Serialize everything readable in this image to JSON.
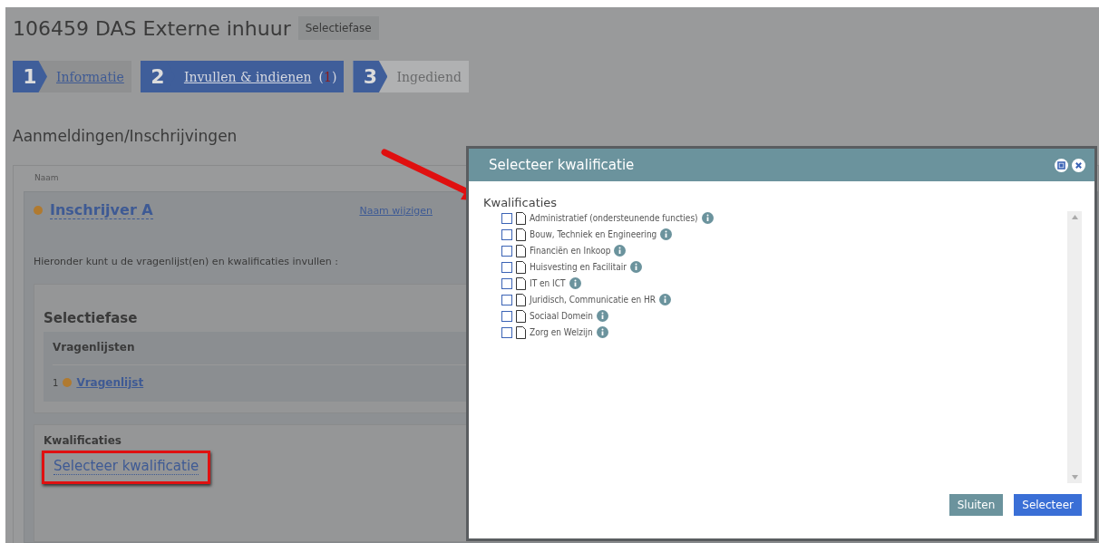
{
  "page": {
    "title": "106459 DAS Externe inhuur",
    "phase_badge": "Selectiefase"
  },
  "steps": [
    {
      "number": "1",
      "label": "Informatie",
      "selected": false,
      "disabled": false
    },
    {
      "number": "2",
      "label": "Invullen & indienen",
      "count": {
        "open": "(",
        "value": "1",
        "close": ")"
      },
      "selected": true,
      "disabled": false
    },
    {
      "number": "3",
      "label": "Ingediend",
      "selected": false,
      "disabled": true
    }
  ],
  "section_title": "Aanmeldingen/Inschrijvingen",
  "registrations": {
    "column_header": "Naam",
    "entrant": {
      "name": "Inschrijver A",
      "rename_link": "Naam wijzigen",
      "instruction": "Hieronder kunt u de vragenlijst(en) en kwalificaties invullen :"
    },
    "phase": {
      "title": "Selectiefase",
      "questionnaires_header": "Vragenlijsten",
      "questionnaires": [
        {
          "index": "1",
          "label": "Vragenlijst"
        }
      ]
    },
    "qualifications": {
      "title": "Kwalificaties",
      "select_link": "Selecteer kwalificatie"
    }
  },
  "dialog": {
    "title": "Selecteer kwalificatie",
    "list_label": "Kwalificaties",
    "items": [
      {
        "label": "Administratief (ondersteunende functies)",
        "checked": false
      },
      {
        "label": "Bouw, Techniek en Engineering",
        "checked": false
      },
      {
        "label": "Financiën en Inkoop",
        "checked": false
      },
      {
        "label": "Huisvesting en Facilitair",
        "checked": false
      },
      {
        "label": "IT en ICT",
        "checked": false
      },
      {
        "label": "Juridisch, Communicatie en HR",
        "checked": false
      },
      {
        "label": "Sociaal Domein",
        "checked": false
      },
      {
        "label": "Zorg en Welzijn",
        "checked": false
      }
    ],
    "buttons": [
      {
        "label": "Sluiten",
        "kind": "secondary"
      },
      {
        "label": "Selecteer",
        "kind": "primary"
      }
    ]
  }
}
